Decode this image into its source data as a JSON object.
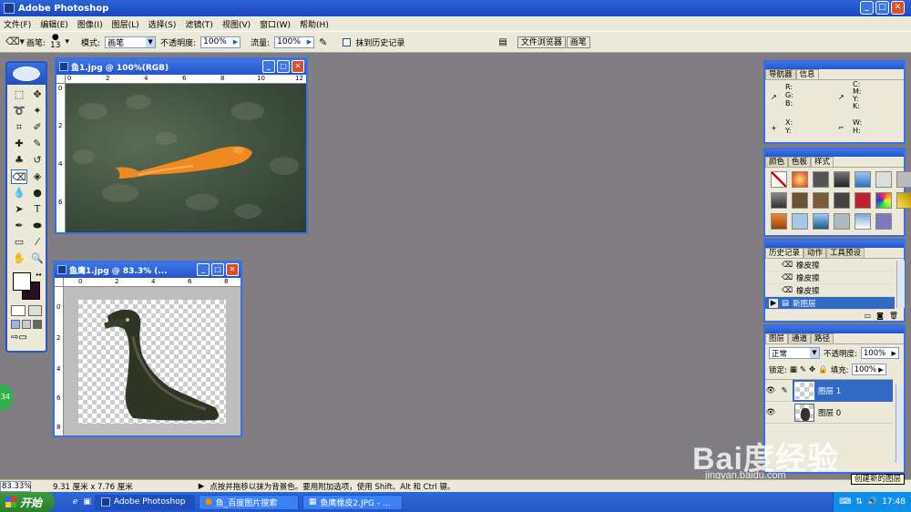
{
  "app": {
    "title": "Adobe Photoshop"
  },
  "menu": [
    "文件(F)",
    "编辑(E)",
    "图像(I)",
    "图层(L)",
    "选择(S)",
    "滤镜(T)",
    "视图(V)",
    "窗口(W)",
    "帮助(H)"
  ],
  "options": {
    "brush_label": "画笔:",
    "brush_size": "13",
    "mode_label": "模式:",
    "mode_value": "画笔",
    "opacity_label": "不透明度:",
    "opacity_value": "100%",
    "flow_label": "流量:",
    "flow_value": "100%",
    "erase_history_label": "抹到历史记录",
    "tab_file_browser": "文件浏览器",
    "tab_brushes": "画笔"
  },
  "doc1": {
    "title": "鱼1.jpg @ 100%(RGB)",
    "ruler": [
      "0",
      "2",
      "4",
      "6",
      "8",
      "10",
      "12"
    ],
    "vruler": [
      "0",
      "2",
      "4",
      "6"
    ]
  },
  "doc2": {
    "title": "鱼鹰1.jpg @ 83.3% (...",
    "ruler": [
      "0",
      "2",
      "4",
      "6",
      "8"
    ],
    "vruler": [
      "0",
      "2",
      "4",
      "6",
      "8"
    ]
  },
  "navigator": {
    "tab1": "导航器",
    "tab2": "信息",
    "r": "R:",
    "g": "G:",
    "b": "B:",
    "c": "C:",
    "m": "M:",
    "y": "Y:",
    "k": "K:",
    "x": "X:",
    "yy": "Y:",
    "w": "W:",
    "h": "H:"
  },
  "color_panel": {
    "tab1": "颜色",
    "tab2": "色板",
    "tab3": "样式"
  },
  "history": {
    "tab1": "历史记录",
    "tab2": "动作",
    "tab3": "工具预设",
    "items": [
      "橡皮擦",
      "橡皮擦",
      "橡皮擦",
      "新图层"
    ]
  },
  "layers": {
    "tab1": "图层",
    "tab2": "通道",
    "tab3": "路径",
    "blend": "正常",
    "opacity_label": "不透明度:",
    "opacity_value": "100%",
    "lock_label": "锁定:",
    "fill_label": "填充:",
    "fill_value": "100%",
    "items": [
      "图层 1",
      "图层 0"
    ],
    "tooltip": "创建新的图层"
  },
  "status": {
    "zoom": "83.33%",
    "doc_size": "9.31 厘米 x 7.76 厘米",
    "hint": "点按并拖移以抹为背景色。要用附加选项，使用 Shift、Alt 和 Ctrl 键。"
  },
  "taskbar": {
    "start": "开始",
    "tasks": [
      "Adobe Photoshop",
      "鱼_百度图片搜索",
      "鱼鹰橡皮2.JPG - ..."
    ],
    "time": "17:48"
  },
  "watermark": {
    "line1": "Bai度经验",
    "line2": "jingyan.baidu.com"
  },
  "colors": {
    "accent": "#2354cc",
    "workspace": "#7f7d82",
    "chrome": "#ece9d8"
  }
}
